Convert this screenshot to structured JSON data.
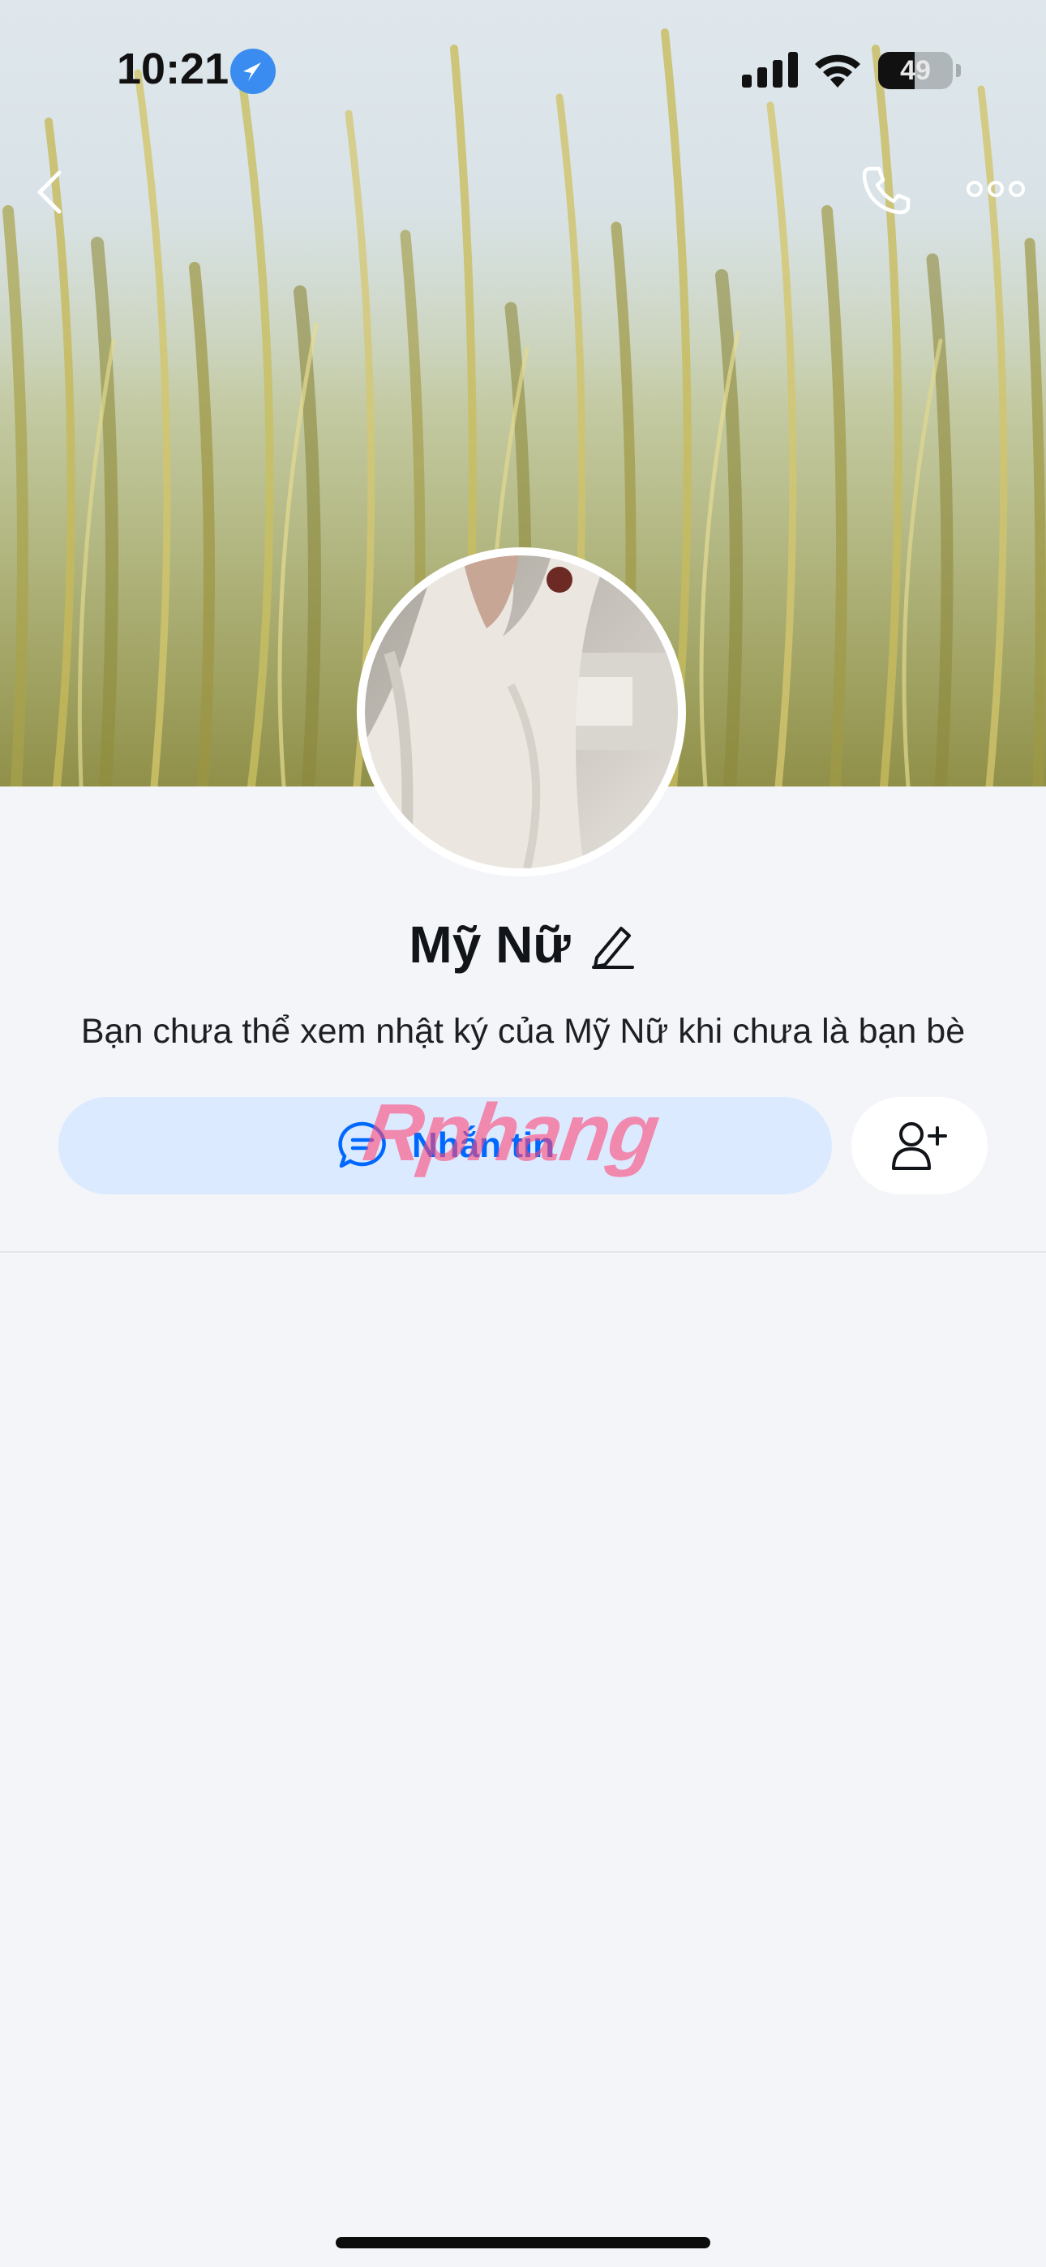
{
  "status_bar": {
    "time": "10:21",
    "battery_level": "49",
    "battery_fraction": 0.49,
    "location_icon": "location-arrow-icon",
    "signal_icon": "cellular-signal-icon",
    "wifi_icon": "wifi-icon"
  },
  "header": {
    "back_icon": "chevron-left-icon",
    "call_icon": "phone-icon",
    "more_icon": "more-horizontal-icon"
  },
  "profile": {
    "name": "Mỹ Nữ",
    "edit_icon": "pencil-icon",
    "notice": "Bạn chưa thể xem nhật ký của Mỹ Nữ khi chưa là bạn bè"
  },
  "actions": {
    "message_label": "Nhắn tin",
    "message_icon": "chat-bubble-icon",
    "add_friend_icon": "add-user-icon"
  },
  "watermark": "Rphang",
  "colors": {
    "accent": "#0068ff",
    "message_button_bg": "#dbeaff",
    "page_bg": "#f3f5f8",
    "location_blue": "#3a8cf0"
  }
}
